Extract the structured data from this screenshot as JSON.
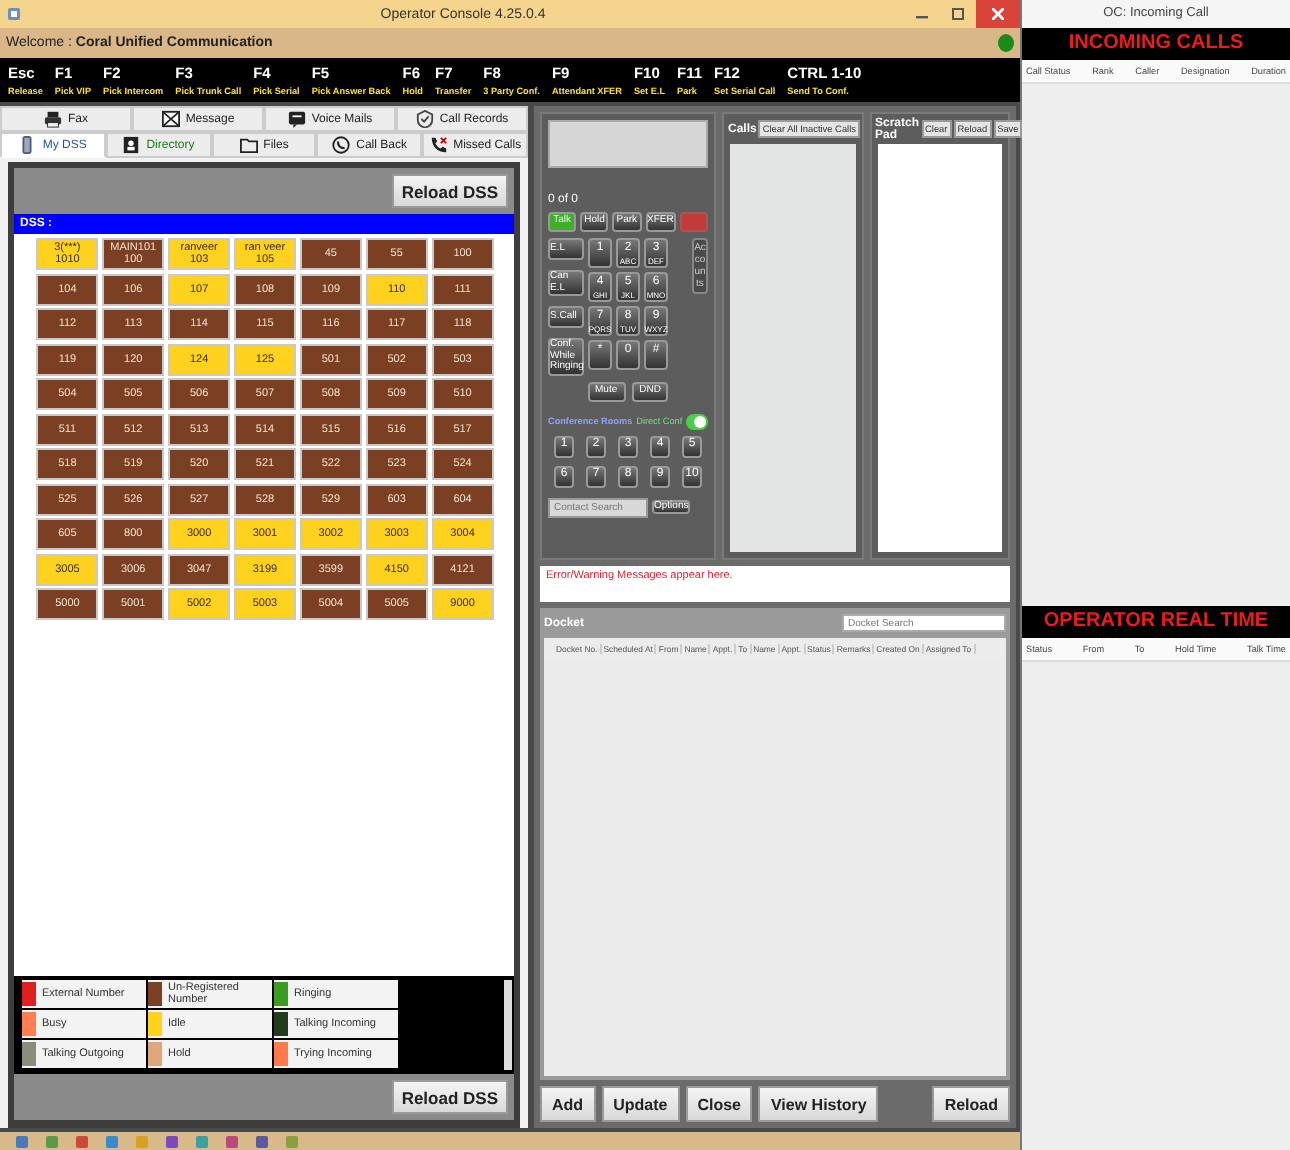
{
  "window": {
    "title": "Operator Console 4.25.0.4"
  },
  "welcome": {
    "text": "Welcome : **Coral Unified Communication**",
    "online": true
  },
  "shortcuts": [
    {
      "key": "Esc",
      "action": "Release"
    },
    {
      "key": "F1",
      "action": "Pick VIP"
    },
    {
      "key": "F2",
      "action": "Pick Intercom"
    },
    {
      "key": "F3",
      "action": "Pick Trunk Call"
    },
    {
      "key": "F4",
      "action": "Pick Serial"
    },
    {
      "key": "F5",
      "action": "Pick Answer Back"
    },
    {
      "key": "F6",
      "action": "Hold"
    },
    {
      "key": "F7",
      "action": "Transfer"
    },
    {
      "key": "F8",
      "action": "3 Party Conf."
    },
    {
      "key": "F9",
      "action": "Attendant XFER"
    },
    {
      "key": "F10",
      "action": "Set E.L"
    },
    {
      "key": "F11",
      "action": "Park"
    },
    {
      "key": "F12",
      "action": "Set Serial Call"
    },
    {
      "key": "CTRL 1-10",
      "action": "Send To Conf."
    }
  ],
  "tabs_top": [
    {
      "label": "Fax",
      "selected": false
    },
    {
      "label": "Message",
      "selected": false
    },
    {
      "label": "Voice Mails",
      "selected": false
    },
    {
      "label": "Call Records",
      "selected": false
    }
  ],
  "tabs_bottom": [
    {
      "label": "My DSS",
      "selected": true
    },
    {
      "label": "Directory",
      "selected": false
    },
    {
      "label": "Files",
      "selected": false
    },
    {
      "label": "Call Back",
      "selected": false
    },
    {
      "label": "Missed Calls",
      "selected": false
    }
  ],
  "dss": {
    "reload_top": "Reload DSS",
    "title": "DSS :",
    "cells": [
      {
        "label": "3(***)",
        "sub": "1010",
        "color": "#ffd21f"
      },
      {
        "label": "MAIN101",
        "sub": "100",
        "color": "#7b3f24"
      },
      {
        "label": "ranveer",
        "sub": "103",
        "color": "#ffd21f"
      },
      {
        "label": "ran veer",
        "sub": "105",
        "color": "#ffd21f"
      },
      {
        "label": "45",
        "color": "#7b3f24"
      },
      {
        "label": "55",
        "color": "#7b3f24"
      },
      {
        "label": "100",
        "color": "#7b3f24"
      },
      {
        "label": "104",
        "color": "#7b3f24"
      },
      {
        "label": "106",
        "color": "#7b3f24"
      },
      {
        "label": "107",
        "color": "#ffd21f"
      },
      {
        "label": "108",
        "color": "#7b3f24"
      },
      {
        "label": "109",
        "color": "#7b3f24"
      },
      {
        "label": "110",
        "color": "#ffd21f"
      },
      {
        "label": "111",
        "color": "#7b3f24"
      },
      {
        "label": "112",
        "color": "#7b3f24"
      },
      {
        "label": "113",
        "color": "#7b3f24"
      },
      {
        "label": "114",
        "color": "#7b3f24"
      },
      {
        "label": "115",
        "color": "#7b3f24"
      },
      {
        "label": "116",
        "color": "#7b3f24"
      },
      {
        "label": "117",
        "color": "#7b3f24"
      },
      {
        "label": "118",
        "color": "#7b3f24"
      },
      {
        "label": "119",
        "color": "#7b3f24"
      },
      {
        "label": "120",
        "color": "#7b3f24"
      },
      {
        "label": "124",
        "color": "#ffd21f"
      },
      {
        "label": "125",
        "color": "#ffd21f"
      },
      {
        "label": "501",
        "color": "#7b3f24"
      },
      {
        "label": "502",
        "color": "#7b3f24"
      },
      {
        "label": "503",
        "color": "#7b3f24"
      },
      {
        "label": "504",
        "color": "#7b3f24"
      },
      {
        "label": "505",
        "color": "#7b3f24"
      },
      {
        "label": "506",
        "color": "#7b3f24"
      },
      {
        "label": "507",
        "color": "#7b3f24"
      },
      {
        "label": "508",
        "color": "#7b3f24"
      },
      {
        "label": "509",
        "color": "#7b3f24"
      },
      {
        "label": "510",
        "color": "#7b3f24"
      },
      {
        "label": "511",
        "color": "#7b3f24"
      },
      {
        "label": "512",
        "color": "#7b3f24"
      },
      {
        "label": "513",
        "color": "#7b3f24"
      },
      {
        "label": "514",
        "color": "#7b3f24"
      },
      {
        "label": "515",
        "color": "#7b3f24"
      },
      {
        "label": "516",
        "color": "#7b3f24"
      },
      {
        "label": "517",
        "color": "#7b3f24"
      },
      {
        "label": "518",
        "color": "#7b3f24"
      },
      {
        "label": "519",
        "color": "#7b3f24"
      },
      {
        "label": "520",
        "color": "#7b3f24"
      },
      {
        "label": "521",
        "color": "#7b3f24"
      },
      {
        "label": "522",
        "color": "#7b3f24"
      },
      {
        "label": "523",
        "color": "#7b3f24"
      },
      {
        "label": "524",
        "color": "#7b3f24"
      },
      {
        "label": "525",
        "color": "#7b3f24"
      },
      {
        "label": "526",
        "color": "#7b3f24"
      },
      {
        "label": "527",
        "color": "#7b3f24"
      },
      {
        "label": "528",
        "color": "#7b3f24"
      },
      {
        "label": "529",
        "color": "#7b3f24"
      },
      {
        "label": "603",
        "color": "#7b3f24"
      },
      {
        "label": "604",
        "color": "#7b3f24"
      },
      {
        "label": "605",
        "color": "#7b3f24"
      },
      {
        "label": "800",
        "color": "#7b3f24"
      },
      {
        "label": "3000",
        "color": "#ffd21f"
      },
      {
        "label": "3001",
        "color": "#ffd21f"
      },
      {
        "label": "3002",
        "color": "#ffd21f"
      },
      {
        "label": "3003",
        "color": "#ffd21f"
      },
      {
        "label": "3004",
        "color": "#ffd21f"
      },
      {
        "label": "3005",
        "color": "#ffd21f"
      },
      {
        "label": "3006",
        "color": "#7b3f24"
      },
      {
        "label": "3047",
        "color": "#7b3f24"
      },
      {
        "label": "3199",
        "color": "#ffd21f"
      },
      {
        "label": "3599",
        "color": "#7b3f24"
      },
      {
        "label": "4150",
        "color": "#ffd21f"
      },
      {
        "label": "4121",
        "color": "#7b3f24"
      },
      {
        "label": "5000",
        "color": "#7b3f24"
      },
      {
        "label": "5001",
        "color": "#7b3f24"
      },
      {
        "label": "5002",
        "color": "#ffd21f"
      },
      {
        "label": "5003",
        "color": "#ffd21f"
      },
      {
        "label": "5004",
        "color": "#7b3f24"
      },
      {
        "label": "5005",
        "color": "#7b3f24"
      },
      {
        "label": "9000",
        "color": "#ffd21f"
      }
    ],
    "legend": [
      {
        "label": "External Number",
        "color": "#e02020"
      },
      {
        "label": "Un-Registered Number",
        "color": "#7b3f24"
      },
      {
        "label": "Ringing",
        "color": "#3a9c20"
      },
      {
        "label": "Busy",
        "color": "#ff7f50"
      },
      {
        "label": "Idle",
        "color": "#ffd21f"
      },
      {
        "label": "Talking Incoming",
        "color": "#1f3d1a"
      },
      {
        "label": "Talking Outgoing",
        "color": "#8c8c7a"
      },
      {
        "label": "Hold",
        "color": "#e0a878"
      },
      {
        "label": "Trying Incoming",
        "color": "#ff7a4a"
      }
    ],
    "reload_bottom": "Reload DSS"
  },
  "dialer": {
    "counter": "0 of 0",
    "call_buttons": [
      {
        "label": "Talk",
        "kind": "talk"
      },
      {
        "label": "Hold",
        "kind": "normal"
      },
      {
        "label": "Park",
        "kind": "normal"
      },
      {
        "label": "XFER",
        "kind": "normal"
      },
      {
        "kind": "end"
      }
    ],
    "side_buttons": [
      "E.L",
      "Can E.L",
      "S.Call",
      "Conf. While Ringing"
    ],
    "keys": [
      {
        "digit": "1"
      },
      {
        "digit": "2",
        "letters": "ABC"
      },
      {
        "digit": "3",
        "letters": "DEF"
      },
      {
        "digit": "4",
        "letters": "GHI"
      },
      {
        "digit": "5",
        "letters": "JKL"
      },
      {
        "digit": "6",
        "letters": "MNO"
      },
      {
        "digit": "7",
        "letters": "PQRS"
      },
      {
        "digit": "8",
        "letters": "TUV"
      },
      {
        "digit": "9",
        "letters": "WXYZ"
      },
      {
        "digit": "*"
      },
      {
        "digit": "0"
      },
      {
        "digit": "#"
      }
    ],
    "accounts": "Accounts",
    "mute": "Mute",
    "dnd": "DND",
    "conference_label": "Conference Rooms",
    "direct_conf": {
      "label": "Direct Conf",
      "on": true
    },
    "rooms": [
      "1",
      "2",
      "3",
      "4",
      "5",
      "6",
      "7",
      "8",
      "9",
      "10"
    ],
    "contact_search": {
      "placeholder": "Contact Search"
    },
    "options": "Options"
  },
  "calls": {
    "title": "Calls",
    "clear": "Clear All Inactive Calls"
  },
  "scratch_pad": {
    "title": "Scratch Pad",
    "buttons": [
      "Clear",
      "Reload",
      "Save"
    ]
  },
  "message": "Error/Warning Messages appear here.",
  "docket": {
    "title": "Docket",
    "search": {
      "placeholder": "Docket Search"
    },
    "columns": [
      "Docket No.",
      "Scheduled At",
      "From",
      "Name",
      "Appt.",
      "To",
      "Name",
      "Appt.",
      "Status",
      "Remarks",
      "Created On",
      "Assigned To"
    ],
    "buttons": [
      "Add",
      "Update",
      "Close",
      "View History"
    ],
    "reload": "Reload"
  },
  "incoming": {
    "title": "OC: Incoming Call",
    "heading": "INCOMING CALLS",
    "columns": [
      "Call Status",
      "Rank",
      "Caller",
      "Designation",
      "Duration"
    ]
  },
  "realtime": {
    "heading": "OPERATOR REAL TIME",
    "columns": [
      "Status",
      "From",
      "To",
      "Hold Time",
      "Talk Time"
    ]
  }
}
